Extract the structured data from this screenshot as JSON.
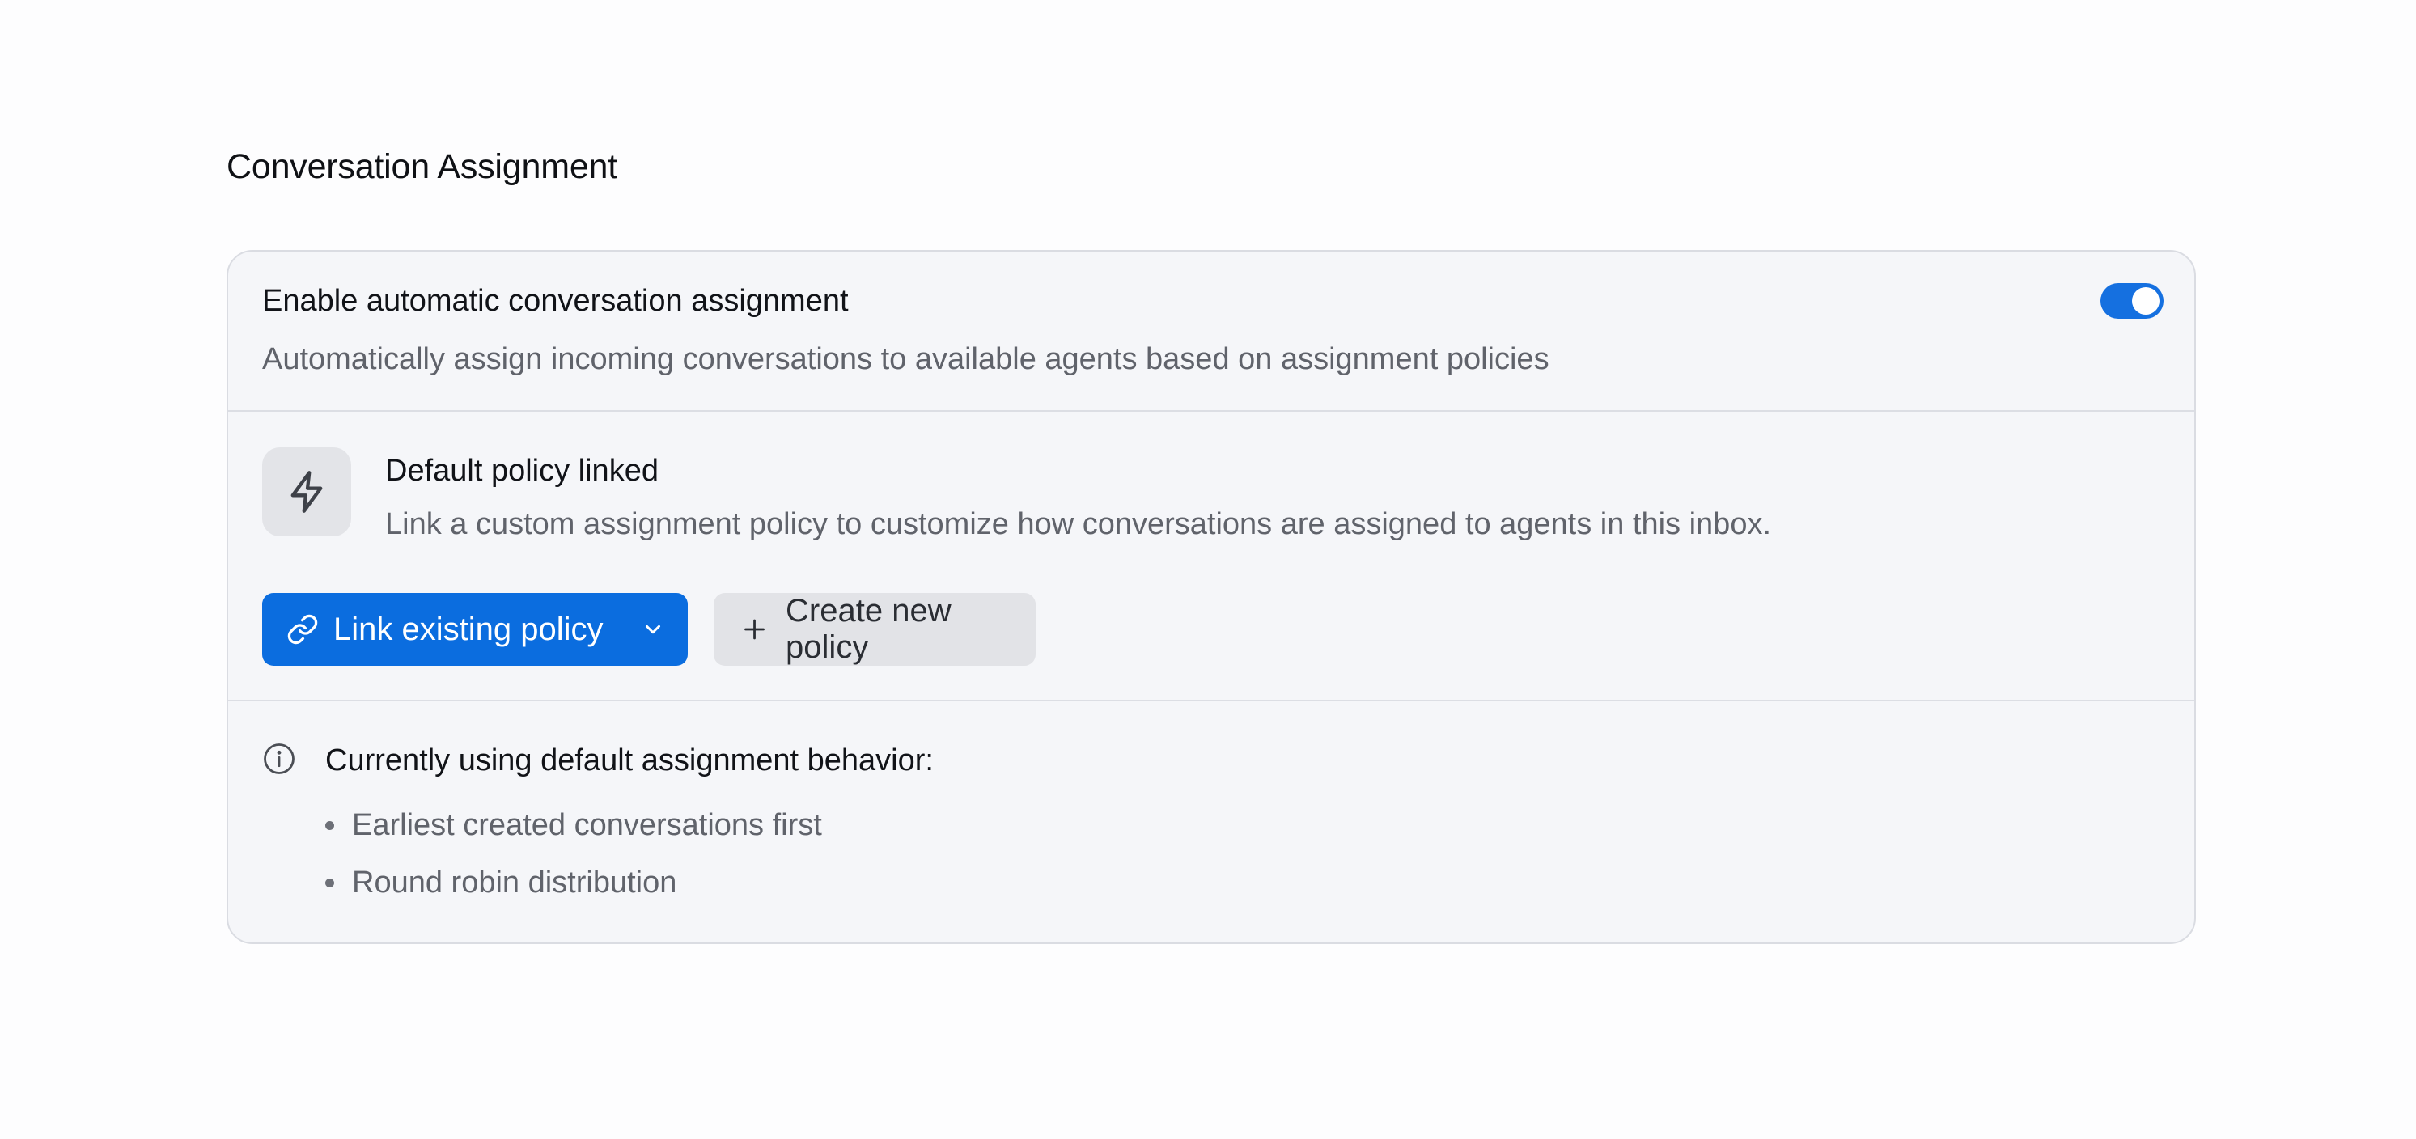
{
  "section": {
    "title": "Conversation Assignment"
  },
  "auto_assign": {
    "title": "Enable automatic conversation assignment",
    "description": "Automatically assign incoming conversations to available agents based on assignment policies",
    "enabled": true
  },
  "policy": {
    "icon": "lightning-bolt-icon",
    "title": "Default policy linked",
    "description": "Link a custom assignment policy to customize how conversations are assigned to agents in this inbox.",
    "link_button_label": "Link existing policy",
    "create_button_label": "Create new policy"
  },
  "default_behavior": {
    "icon": "info-circle-icon",
    "title": "Currently using default assignment behavior:",
    "items": [
      "Earliest created conversations first",
      "Round robin distribution"
    ]
  },
  "colors": {
    "accent": "#0b6ddf",
    "toggle_on": "#1570e0",
    "card_bg": "#f5f6f9",
    "muted_text": "#60636b"
  }
}
